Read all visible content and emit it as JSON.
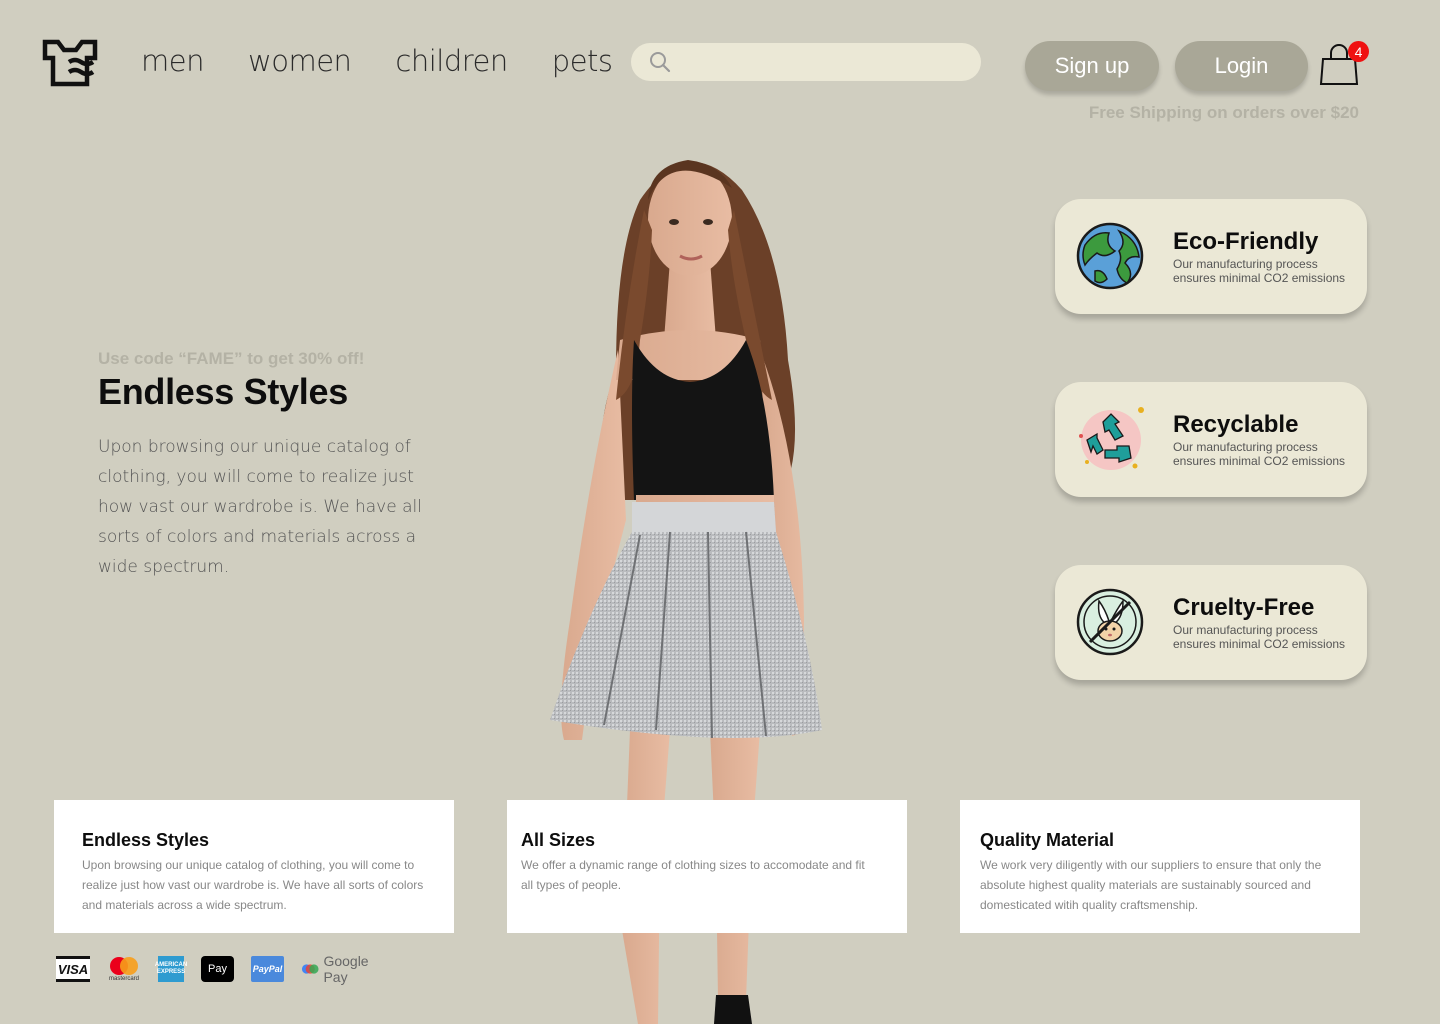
{
  "header": {
    "nav": [
      "men",
      "women",
      "children",
      "pets"
    ],
    "search_placeholder": "",
    "signup_label": "Sign up",
    "login_label": "Login",
    "cart_count": "4",
    "shipping_note": "Free Shipping on orders over $20"
  },
  "hero": {
    "promo": "Use code “FAME” to get 30% off!",
    "title": "Endless Styles",
    "body": "Upon browsing our unique catalog of clothing, you will come to realize just how vast our wardrobe is. We have all sorts of colors and materials across a wide spectrum."
  },
  "features": [
    {
      "title": "Eco-Friendly",
      "desc": "Our manufacturing process ensures minimal CO2 emissions",
      "icon": "earth-icon"
    },
    {
      "title": "Recyclable",
      "desc": "Our manufacturing process ensures minimal CO2 emissions",
      "icon": "recycle-icon"
    },
    {
      "title": "Cruelty-Free",
      "desc": "Our manufacturing process ensures minimal CO2 emissions",
      "icon": "cruelty-free-bunny-icon"
    }
  ],
  "info_cards": [
    {
      "title": "Endless Styles",
      "desc": "Upon browsing our unique catalog of clothing, you will come to realize just how vast our wardrobe is. We have all sorts of colors and materials across a wide spectrum."
    },
    {
      "title": "All Sizes",
      "desc": "We offer a dynamic range of clothing sizes to accomodate and fit all types of people."
    },
    {
      "title": "Quality Material",
      "desc": "We work very diligently with our suppliers to ensure that only the absolute highest quality materials are sustainably sourced and domesticated witih quality craftsmenship."
    }
  ],
  "payments": {
    "visa": "VISA",
    "mastercard": "mastercard",
    "amex": "AMERICAN EXPRESS",
    "apple_pay": " Pay",
    "paypal": "PayPal",
    "google_pay": "Google Pay"
  },
  "colors": {
    "background": "#d0cec0",
    "card_bg": "#ebe8d6",
    "button_bg": "#a9a797",
    "muted_text": "#b4b2a5",
    "badge": "#ef1111"
  }
}
